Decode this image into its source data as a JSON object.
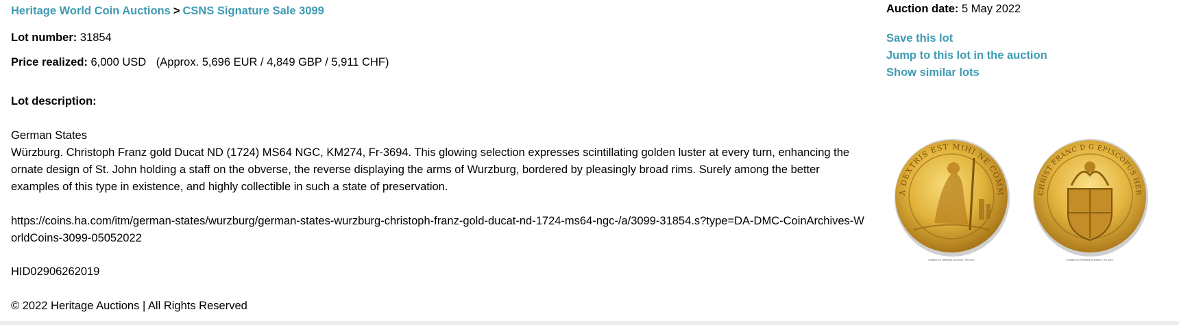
{
  "breadcrumb": {
    "auction_house": "Heritage World Coin Auctions",
    "separator": ">",
    "sale": "CSNS Signature Sale 3099"
  },
  "lot": {
    "number_label": "Lot number:",
    "number": "31854",
    "price_label": "Price realized:",
    "price": "6,000 USD",
    "price_approx": "(Approx. 5,696 EUR / 4,849 GBP / 5,911 CHF)",
    "description_label": "Lot description:",
    "description_heading": "German States",
    "description_body": "Würzburg. Christoph Franz gold Ducat ND (1724) MS64 NGC, KM274, Fr-3694. This glowing selection expresses scintillating golden luster at every turn, enhancing the ornate design of St. John holding a staff on the obverse, the reverse displaying the arms of Wurzburg, bordered by pleasingly broad rims. Surely among the better examples of this type in existence, and highly collectible in such a state of preservation.",
    "source_url": "https://coins.ha.com/itm/german-states/wurzburg/german-states-wurzburg-christoph-franz-gold-ducat-nd-1724-ms64-ngc-/a/3099-31854.s?type=DA-DMC-CoinArchives-WorldCoins-3099-05052022",
    "hid": "HID02906262019"
  },
  "footer": {
    "copyright": "© 2022 Heritage Auctions | All Rights Reserved"
  },
  "sidebar": {
    "auction_date_label": "Auction date:",
    "auction_date": "5 May 2022",
    "actions": [
      {
        "label": "Save this lot"
      },
      {
        "label": "Jump to this lot in the auction"
      },
      {
        "label": "Show similar lots"
      }
    ]
  },
  "coins": {
    "obverse_legend": "A DEXTRIS EST MIHI NE COMMOVEAR",
    "reverse_legend": "CHRIST FRANC D G EPISCOPUS HERBIPOL FRANCIAE OR DUX",
    "caption": "Images by Heritage Auctions, HA.com",
    "gold_color": "#e2b33c",
    "gold_dark": "#a9761a"
  }
}
